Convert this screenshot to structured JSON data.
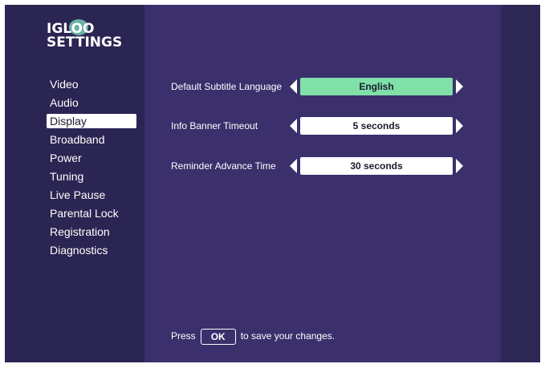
{
  "app": {
    "logo_line1": "IGLOO",
    "logo_line2": "SETTINGS"
  },
  "menu": {
    "items": [
      {
        "label": "Video"
      },
      {
        "label": "Audio"
      },
      {
        "label": "Display",
        "selected": true
      },
      {
        "label": "Broadband"
      },
      {
        "label": "Power"
      },
      {
        "label": "Tuning"
      },
      {
        "label": "Live Pause"
      },
      {
        "label": "Parental Lock"
      },
      {
        "label": "Registration"
      },
      {
        "label": "Diagnostics"
      }
    ]
  },
  "settings": [
    {
      "label": "Default Subtitle Language",
      "value": "English",
      "active": true
    },
    {
      "label": "Info Banner Timeout",
      "value": "5 seconds",
      "active": false
    },
    {
      "label": "Reminder Advance Time",
      "value": "30 seconds",
      "active": false
    }
  ],
  "footer": {
    "prefix": "Press",
    "ok_label": "OK",
    "suffix": "to save your changes."
  },
  "colors": {
    "background": "#3b2f6c",
    "sidebar": "#2a2552",
    "active_value": "#7fe0a8",
    "selected_menu": "#ffffff"
  }
}
